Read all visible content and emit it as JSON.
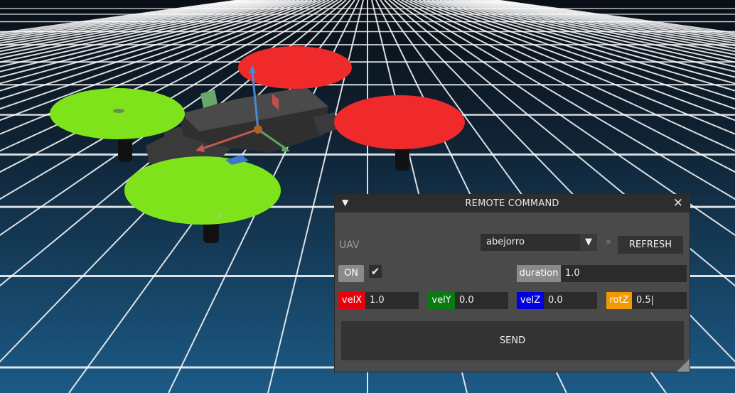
{
  "window": {
    "title": "REMOTE COMMAND",
    "collapse_icon": "▼",
    "close_icon": "✕"
  },
  "uav": {
    "label": "UAV",
    "selected": "abejorro",
    "dropdown_icon": "▼",
    "refresh_label": "REFRESH"
  },
  "toggle": {
    "on_label": "ON",
    "checkbox_glyph": "✔",
    "checked": true
  },
  "duration": {
    "label": "duration",
    "value": "1.0"
  },
  "velocities": {
    "velX": {
      "label": "velX",
      "value": "1.0",
      "color": "#e8000f"
    },
    "velY": {
      "label": "velY",
      "value": "0.0",
      "color": "#0a7a12"
    },
    "velZ": {
      "label": "velZ",
      "value": "0.0",
      "color": "#0000e0"
    },
    "rotZ": {
      "label": "rotZ",
      "value": "0.5|",
      "color": "#f09a00"
    }
  },
  "send_label": "SEND",
  "colors": {
    "panel_bg": "#4a4a4a",
    "titlebar_bg": "#2d2d2d",
    "rotor_green": "#7fe31b",
    "rotor_red": "#f0292b",
    "grid_line": "#ffffff"
  }
}
